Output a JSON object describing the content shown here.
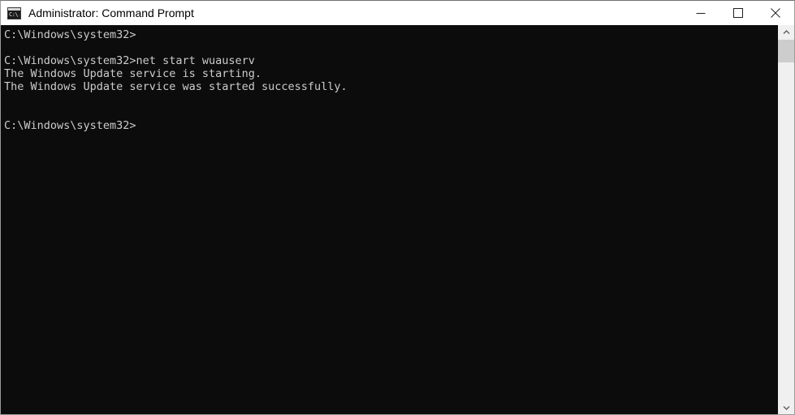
{
  "window": {
    "title": "Administrator: Command Prompt",
    "icon": "console-icon",
    "icon_text": "C:\\.",
    "background_color": "#0c0c0c",
    "titlebar_color": "#ffffff",
    "text_color": "#cccccc"
  },
  "titlebar": {
    "minimize_label": "Minimize",
    "maximize_label": "Maximize",
    "close_label": "Close"
  },
  "console": {
    "content": "C:\\Windows\\system32>\n\nC:\\Windows\\system32>net start wuauserv\nThe Windows Update service is starting.\nThe Windows Update service was started successfully.\n\n\nC:\\Windows\\system32>",
    "lines": [
      "C:\\Windows\\system32>",
      "",
      "C:\\Windows\\system32>net start wuauserv",
      "The Windows Update service is starting.",
      "The Windows Update service was started successfully.",
      "",
      "",
      "C:\\Windows\\system32>"
    ],
    "prompt": "C:\\Windows\\system32>",
    "command": "net start wuauserv",
    "output": [
      "The Windows Update service is starting.",
      "The Windows Update service was started successfully."
    ]
  },
  "scrollbar": {
    "up_label": "Scroll up",
    "down_label": "Scroll down",
    "thumb_label": "Scroll thumb"
  }
}
